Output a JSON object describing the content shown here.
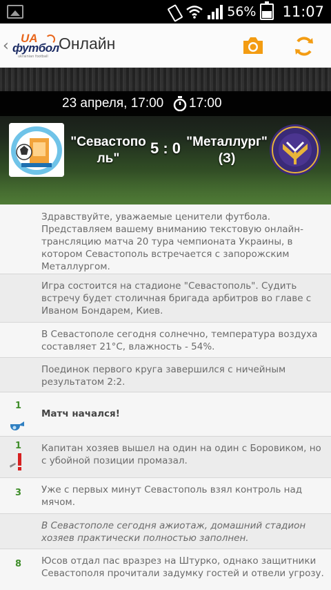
{
  "status_bar": {
    "battery_percent": "56%",
    "time": "11:07",
    "icons": [
      "image-icon",
      "vibrate-icon",
      "wifi-icon",
      "signal-icon",
      "battery-icon"
    ]
  },
  "action_bar": {
    "logo": {
      "top": "UA",
      "main": "футбол",
      "sub": "ukrainian football"
    },
    "title": "Онлайн",
    "actions": [
      "camera-icon",
      "refresh-icon"
    ],
    "accent_color": "#f39c12"
  },
  "match": {
    "date": "23 апреля, 17:00",
    "kickoff": "17:00",
    "home_team": "\"Севастополь\"",
    "away_team": "\"Металлург\" (З)",
    "score": "5 : 0"
  },
  "feed": [
    {
      "minute": "",
      "icon": "",
      "style": "normal",
      "text": "Здравствуйте, уважаемые ценители футбола. Представляем вашему вниманию текстовую онлайн-трансляцию матча 20 тура чемпионата Украины, в котором Севастополь встречается с запорожским Металлургом."
    },
    {
      "minute": "",
      "icon": "",
      "style": "normal",
      "text": "Игра состоится на стадионе \"Севастополь\". Судить встречу будет столичная бригада арбитров во главе с Иваном Бондарем, Киев."
    },
    {
      "minute": "",
      "icon": "",
      "style": "normal",
      "text": "В Севастополе сегодня солнечно, температура воздуха составляет 21°C, влажность - 54%."
    },
    {
      "minute": "",
      "icon": "",
      "style": "normal",
      "text": "Поединок первого круга завершился с ничейным результатом 2:2."
    },
    {
      "minute": "1",
      "icon": "whistle-icon",
      "style": "bold",
      "text": "Матч начался!"
    },
    {
      "minute": "1",
      "icon": "exclamation-icon",
      "style": "normal",
      "text": "Капитан хозяев вышел на один на один с Боровиком, но с убойной позиции промазал."
    },
    {
      "minute": "3",
      "icon": "",
      "style": "normal",
      "text": "Уже с первых минут Севастополь взял контроль над мячом."
    },
    {
      "minute": "",
      "icon": "",
      "style": "italic",
      "text": "В Севастополе сегодня ажиотаж, домашний стадион хозяев практически полностью заполнен."
    },
    {
      "minute": "8",
      "icon": "",
      "style": "normal",
      "text": "Юсов отдал пас вразрез на Штурко, однако защитники Севастополя прочитали задумку гостей и отвели угрозу."
    }
  ]
}
